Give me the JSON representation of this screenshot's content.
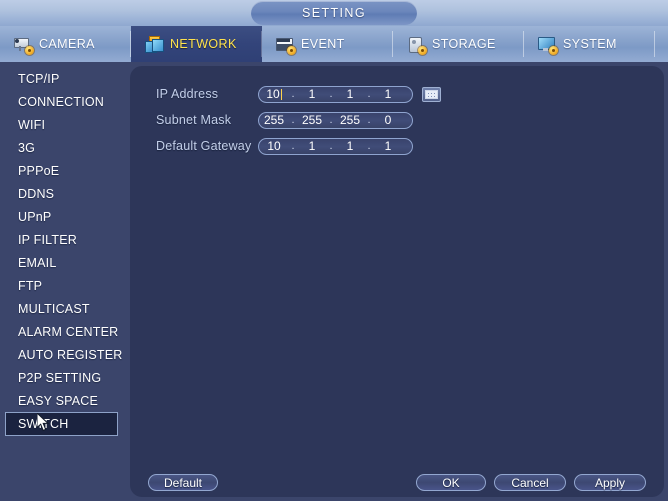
{
  "window": {
    "title": "SETTING"
  },
  "tabs": [
    {
      "label": "CAMERA",
      "icon": "camera-icon",
      "active": false
    },
    {
      "label": "NETWORK",
      "icon": "network-icon",
      "active": true
    },
    {
      "label": "EVENT",
      "icon": "event-icon",
      "active": false
    },
    {
      "label": "STORAGE",
      "icon": "storage-icon",
      "active": false
    },
    {
      "label": "SYSTEM",
      "icon": "system-icon",
      "active": false
    }
  ],
  "sidebar": {
    "selected": "SWITCH",
    "items": [
      {
        "label": "TCP/IP"
      },
      {
        "label": "CONNECTION"
      },
      {
        "label": "WIFI"
      },
      {
        "label": "3G"
      },
      {
        "label": "PPPoE"
      },
      {
        "label": "DDNS"
      },
      {
        "label": "UPnP"
      },
      {
        "label": "IP FILTER"
      },
      {
        "label": "EMAIL"
      },
      {
        "label": "FTP"
      },
      {
        "label": "MULTICAST"
      },
      {
        "label": "ALARM CENTER"
      },
      {
        "label": "AUTO REGISTER"
      },
      {
        "label": "P2P SETTING"
      },
      {
        "label": "EASY SPACE"
      },
      {
        "label": "SWITCH"
      }
    ]
  },
  "form": {
    "fields": [
      {
        "label": "IP Address",
        "name": "ip-address",
        "octets": [
          "10",
          "1",
          "1",
          "1"
        ],
        "focused": true,
        "caret_after_octet": 0,
        "has_keyboard_button": true
      },
      {
        "label": "Subnet Mask",
        "name": "subnet-mask",
        "octets": [
          "255",
          "255",
          "255",
          "0"
        ],
        "focused": false,
        "has_keyboard_button": false
      },
      {
        "label": "Default Gateway",
        "name": "default-gateway",
        "octets": [
          "10",
          "1",
          "1",
          "1"
        ],
        "focused": false,
        "has_keyboard_button": false
      }
    ],
    "separator": ".",
    "keyboard_button_icon": "keypad-icon"
  },
  "footer": {
    "default_label": "Default",
    "ok_label": "OK",
    "cancel_label": "Cancel",
    "apply_label": "Apply"
  },
  "colors": {
    "panel_bg": "#2d3659",
    "sidebar_bg": "#3b456b",
    "titlebar_top": "#bdcde6",
    "tab_active_text": "#ffe34d",
    "tab_active_bg": "#33447a",
    "field_border": "#8fa4cf",
    "label_text": "#c3cfe9",
    "selected_item_bg": "#1b2340",
    "caret": "#ffd34d"
  },
  "cursor": {
    "icon": "mouse-pointer-icon",
    "over": "SWITCH"
  }
}
